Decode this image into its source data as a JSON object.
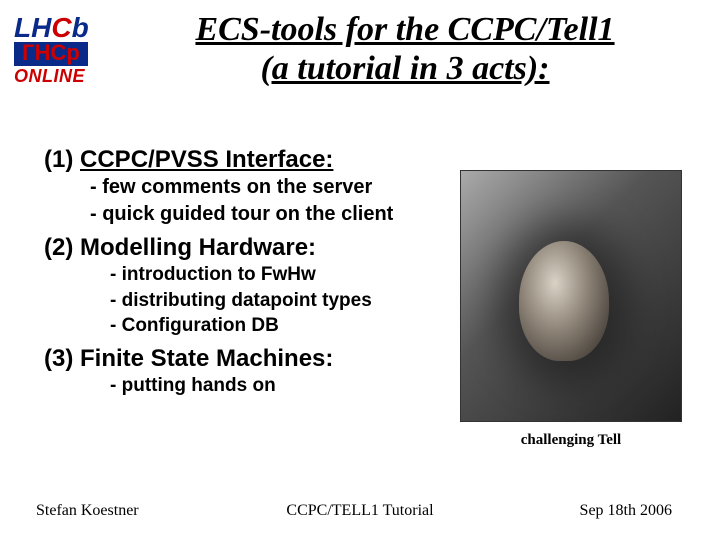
{
  "logo": {
    "top_lh": "LH",
    "top_c": "C",
    "top_b": "b",
    "mid": "ГНСр",
    "bottom": "ONLINE"
  },
  "title_line1": "ECS-tools for the CCPC/Tell1",
  "title_line2": "(a tutorial in 3 acts):",
  "sections": [
    {
      "num": "(1)",
      "head": "CCPC/PVSS Interface:",
      "underline": true,
      "subs": [
        "-  few comments on the server",
        "-  quick guided tour on the client"
      ],
      "indent": "sub"
    },
    {
      "num": "(2)",
      "head": "Modelling Hardware:",
      "underline": false,
      "subs": [
        "- introduction to FwHw",
        "- distributing datapoint types",
        "- Configuration DB"
      ],
      "indent": "sub2"
    },
    {
      "num": "(3)",
      "head": "Finite State Machines:",
      "underline": false,
      "subs": [
        "- putting hands on"
      ],
      "indent": "sub2"
    }
  ],
  "caption": "challenging Tell",
  "footer": {
    "left": "Stefan Koestner",
    "mid": "CCPC/TELL1 Tutorial",
    "right": "Sep 18th 2006"
  }
}
